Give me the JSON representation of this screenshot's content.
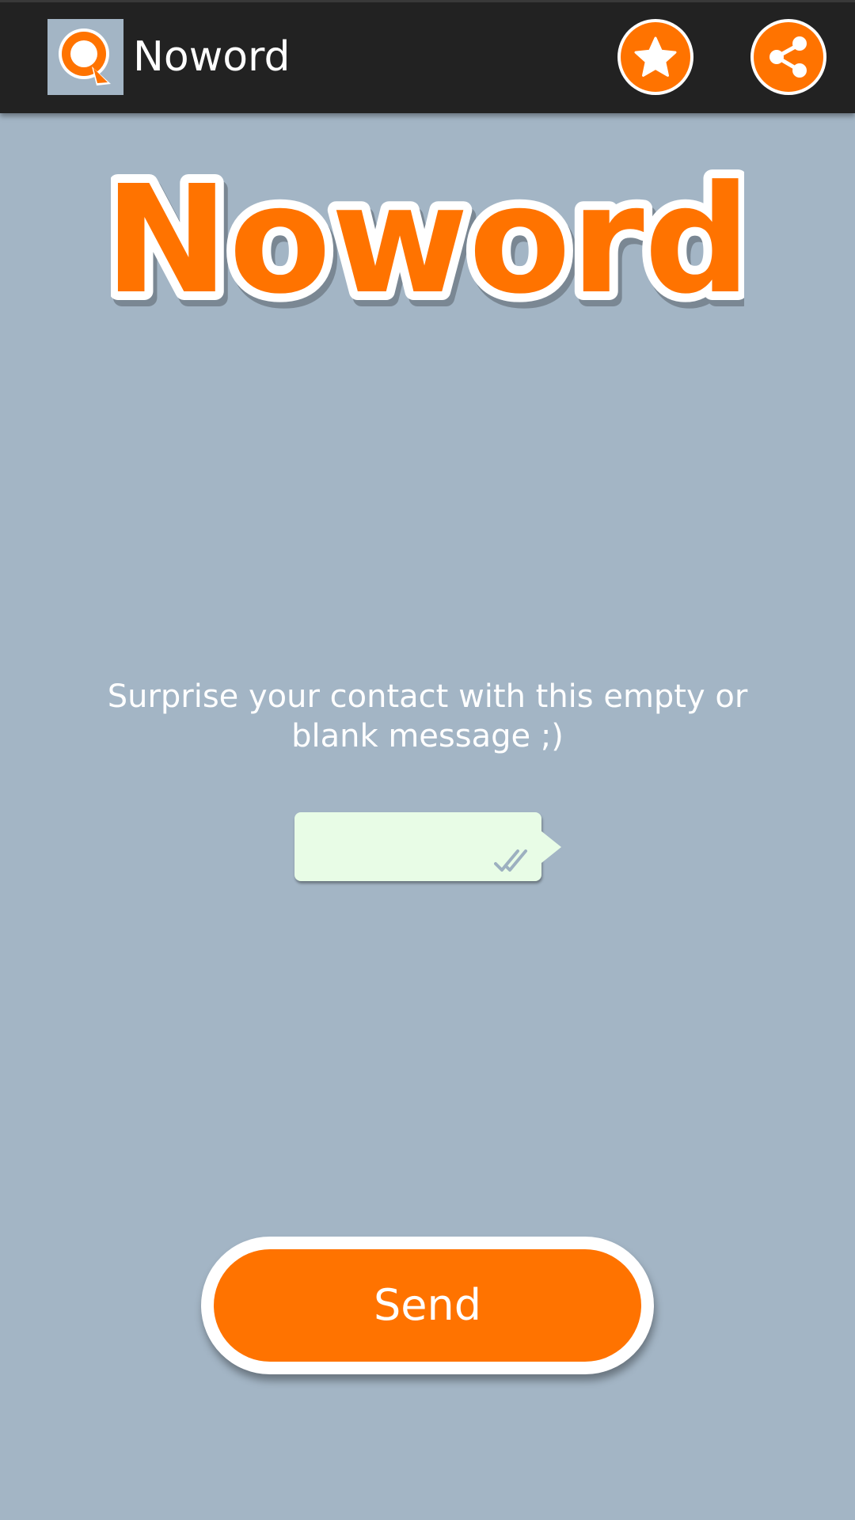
{
  "app": {
    "title": "Noword",
    "icon": "noword-chat-bubble-icon"
  },
  "toolbar": {
    "rate_icon": "star-icon",
    "share_icon": "share-icon"
  },
  "logo": {
    "text": "Noword"
  },
  "main": {
    "prompt": "Surprise your contact with this empty or blank message ;)",
    "bubble_status_icon": "double-check-icon"
  },
  "send_button": {
    "label": "Send"
  },
  "colors": {
    "accent": "#ff7300",
    "background": "#a3b5c5",
    "action_bar": "#222222",
    "bubble": "#e8fce6"
  }
}
